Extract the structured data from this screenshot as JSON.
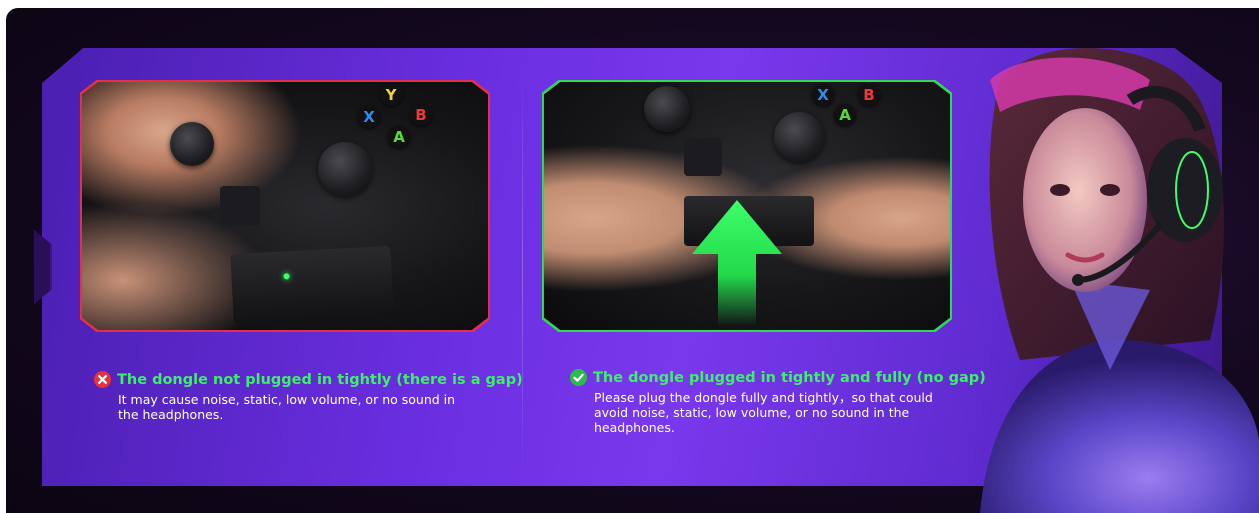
{
  "left_caption": {
    "title": "The dongle not plugged in tightly (there is a gap)",
    "description": "It may cause noise, static, low volume, or no sound in the headphones.",
    "status_icon": "x-icon",
    "status_color": "#e8313b"
  },
  "right_caption": {
    "title": "The dongle plugged in tightly and fully (no gap)",
    "description": "Please plug the dongle fully and tightly，so that could avoid noise, static, low volume, or no sound in the headphones.",
    "status_icon": "check-icon",
    "status_color": "#2dbb4f"
  },
  "controller_buttons": {
    "y": "Y",
    "x": "X",
    "b": "B",
    "a": "A"
  },
  "colors": {
    "bad_frame": "#e0304a",
    "good_frame": "#2dd85a",
    "title_green": "#3df06a",
    "panel_purple": "#6a2ee0"
  }
}
